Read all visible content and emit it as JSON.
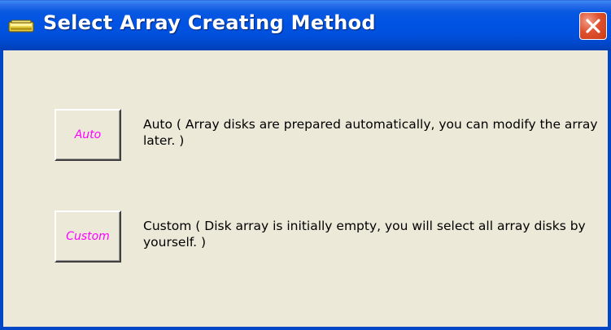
{
  "window": {
    "title": "Select Array Creating Method",
    "icon": "disk-array-icon",
    "close_icon": "close-icon"
  },
  "options": [
    {
      "button_label": "Auto",
      "description": "Auto ( Array disks are prepared automatically, you can modify the array later. )"
    },
    {
      "button_label": "Custom",
      "description": "Custom ( Disk array is initially empty, you will select all array disks by yourself. )"
    }
  ],
  "colors": {
    "titlebar": "#0053e3",
    "window_bg": "#ece9d8",
    "button_text": "#ff00ff",
    "close_button": "#e0502e"
  }
}
